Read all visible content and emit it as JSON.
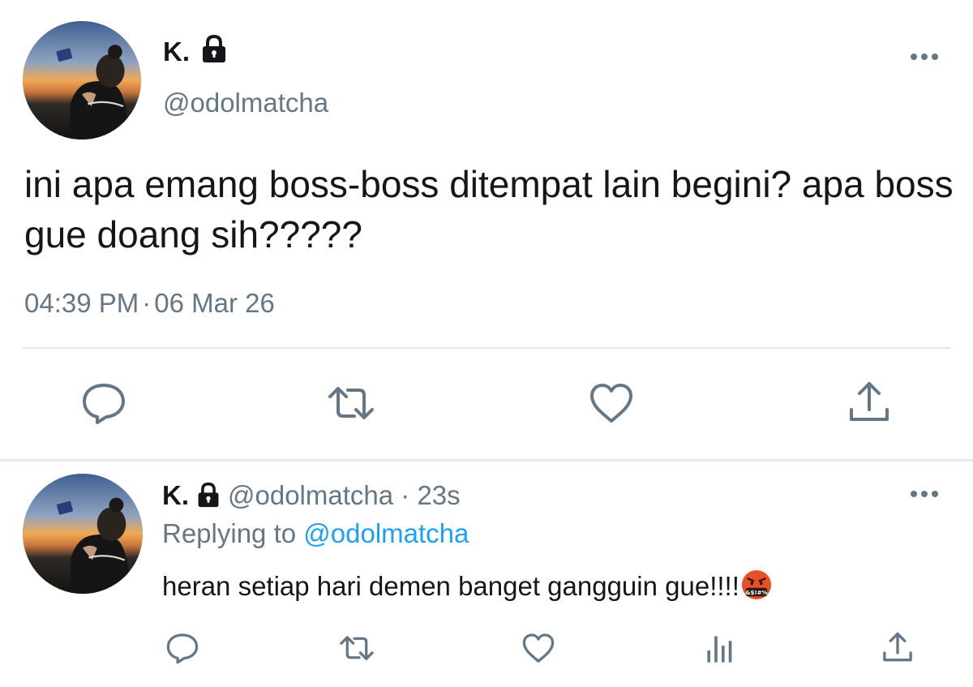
{
  "main_tweet": {
    "display_name": "K.",
    "handle": "@odolmatcha",
    "text": "ini apa emang boss-boss ditempat lain begini? apa boss gue doang sih?????",
    "time": "04:39 PM",
    "date": "06 Mar 26",
    "separator": "·",
    "protected_icon": "lock-icon",
    "actions": [
      "reply-icon",
      "retweet-icon",
      "like-icon",
      "share-icon"
    ]
  },
  "reply_tweet": {
    "display_name": "K.",
    "handle": "@odolmatcha",
    "separator": "·",
    "time_ago": "23s",
    "replying_prefix": "Replying to",
    "replying_to": "@odolmatcha",
    "text": "heran setiap hari demen banget gangguin gue!!!!",
    "emoji": "face-with-symbols-on-mouth",
    "protected_icon": "lock-icon",
    "actions": [
      "reply-icon",
      "retweet-icon",
      "like-icon",
      "analytics-icon",
      "share-icon"
    ]
  },
  "colors": {
    "text_primary": "#14171a",
    "text_secondary": "#657786",
    "link": "#1da1f2",
    "divider": "#e1e8ed",
    "icon": "#657786"
  }
}
